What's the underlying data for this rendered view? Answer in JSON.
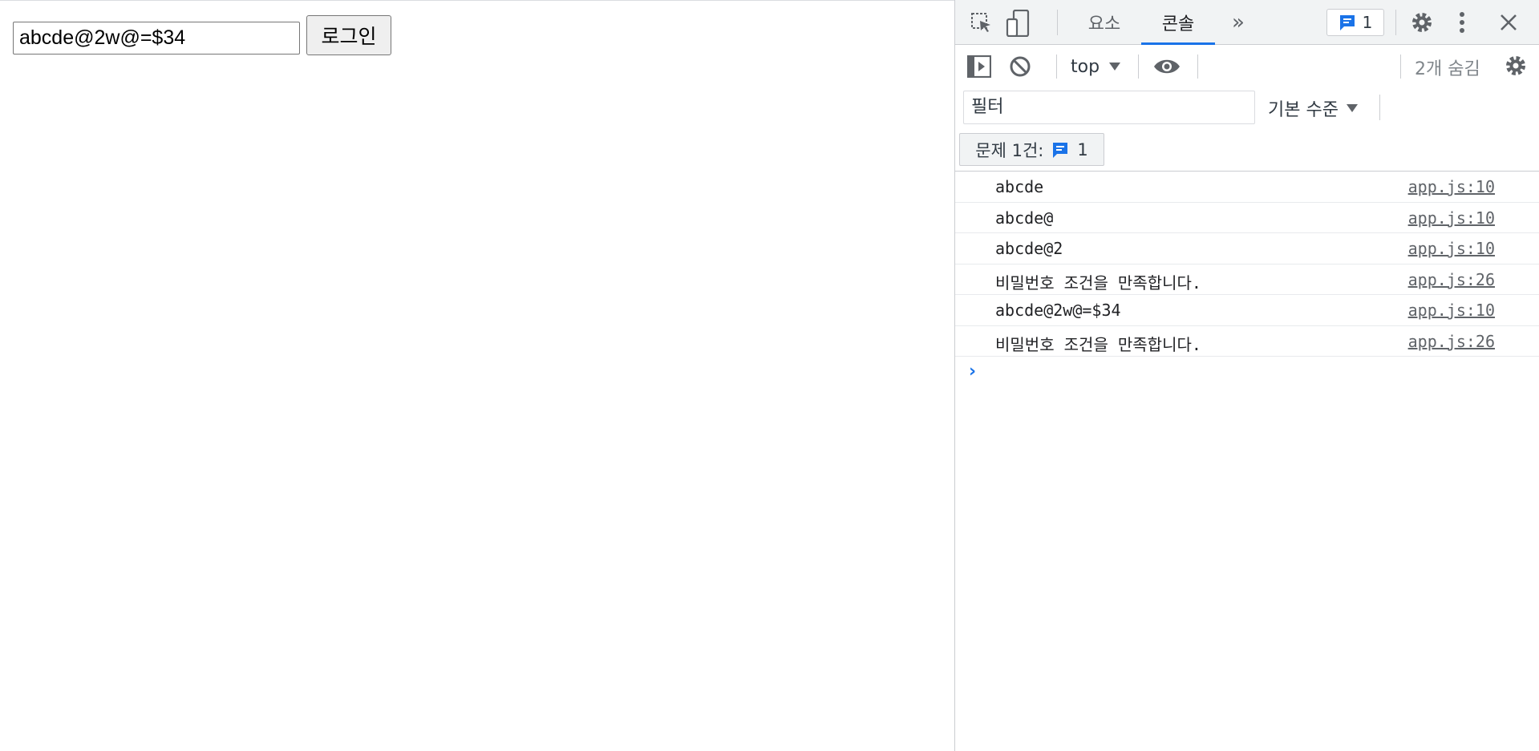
{
  "page": {
    "password_value": "abcde@2w@=$34",
    "login_label": "로그인"
  },
  "devtools": {
    "tabs": [
      {
        "label": "요소",
        "active": false
      },
      {
        "label": "콘솔",
        "active": true
      }
    ],
    "more_tabs_glyph": "»",
    "issue_count": "1",
    "context": "top",
    "hidden_count_label": "2개 숨김",
    "filter_placeholder": "필터",
    "level_label": "기본 수준",
    "issues_label": "문제 1건:",
    "issues_count": "1",
    "console_rows": [
      {
        "message": "abcde",
        "source": "app.js:10"
      },
      {
        "message": "abcde@",
        "source": "app.js:10"
      },
      {
        "message": "abcde@2",
        "source": "app.js:10"
      },
      {
        "message": "비밀번호 조건을 만족합니다.",
        "source": "app.js:26"
      },
      {
        "message": "abcde@2w@=$34",
        "source": "app.js:10"
      },
      {
        "message": "비밀번호 조건을 만족합니다.",
        "source": "app.js:26"
      }
    ],
    "prompt_glyph": "›",
    "accent_color": "#1a73e8"
  }
}
